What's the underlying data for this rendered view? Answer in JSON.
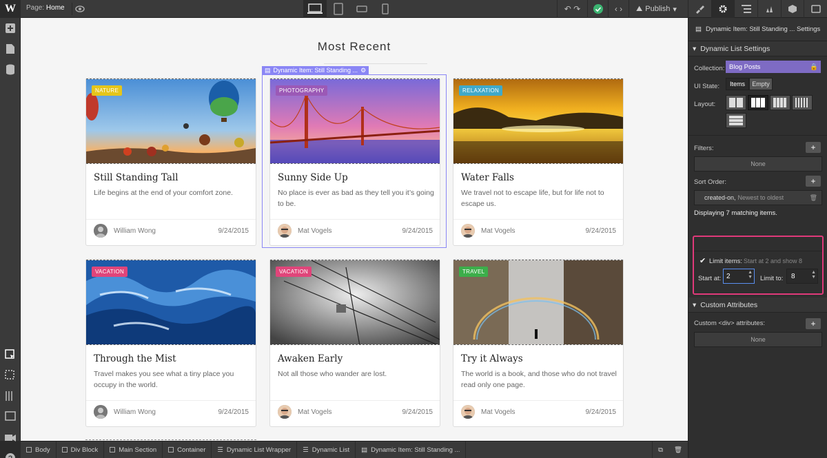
{
  "topbar": {
    "page_label": "Page:",
    "page_name": "Home",
    "publish": "Publish"
  },
  "canvas": {
    "heading": "Most Recent",
    "selected_tag": "Dynamic Item: Still Standing ..."
  },
  "cards": [
    {
      "tag": "NATURE",
      "tag_color": "#e5c51a",
      "title": "Still Standing Tall",
      "desc": "Life begins at the end of your comfort zone.",
      "author": "William Wong",
      "date": "9/24/2015"
    },
    {
      "tag": "PHOTOGRAPHY",
      "tag_color": "#9b59b6",
      "title": "Sunny Side Up",
      "desc": "No place is ever as bad as they tell you it’s going to be.",
      "author": "Mat Vogels",
      "date": "9/24/2015"
    },
    {
      "tag": "RELAXATION",
      "tag_color": "#3fa9c9",
      "title": "Water Falls",
      "desc": "We travel not to escape life, but for life not to escape us.",
      "author": "Mat Vogels",
      "date": "9/24/2015"
    },
    {
      "tag": "VACATION",
      "tag_color": "#e0457a",
      "title": "Through the Mist",
      "desc": "Travel makes you see what a tiny place you occupy in the world.",
      "author": "William Wong",
      "date": "9/24/2015"
    },
    {
      "tag": "VACATION",
      "tag_color": "#e0457a",
      "title": "Awaken Early",
      "desc": "Not all those who wander are lost.",
      "author": "Mat Vogels",
      "date": "9/24/2015"
    },
    {
      "tag": "TRAVEL",
      "tag_color": "#3cae4a",
      "title": "Try it Always",
      "desc": "The world is a book, and those who do not travel read only one page.",
      "author": "Mat Vogels",
      "date": "9/24/2015"
    }
  ],
  "breadcrumb": [
    "Body",
    "Div Block",
    "Main Section",
    "Container",
    "Dynamic List Wrapper",
    "Dynamic List",
    "Dynamic Item: Still Standing ..."
  ],
  "panel": {
    "header": "Dynamic Item: Still Standing ... Settings",
    "section1": "Dynamic List Settings",
    "collection_label": "Collection:",
    "collection_value": "Blog Posts",
    "ui_state_label": "UI State:",
    "ui_state_items": "Items",
    "ui_state_empty": "Empty",
    "layout_label": "Layout:",
    "filters_label": "Filters:",
    "filters_value": "None",
    "sort_label": "Sort Order:",
    "sort_field": "created-on,",
    "sort_dir": "Newest to oldest",
    "displaying": "Displaying 7 matching items.",
    "limit_label": "Limit items:",
    "limit_hint": "Start at 2 and show 8",
    "start_label": "Start at:",
    "start_value": "2",
    "limit_to_label": "Limit to:",
    "limit_to_value": "8",
    "section2": "Custom Attributes",
    "custom_label": "Custom <div> attributes:",
    "custom_value": "None"
  },
  "colors": {
    "accent": "#8a86f5",
    "highlight": "#e0397a",
    "publish_check": "#3cb371",
    "collection": "#7e6bc4"
  }
}
